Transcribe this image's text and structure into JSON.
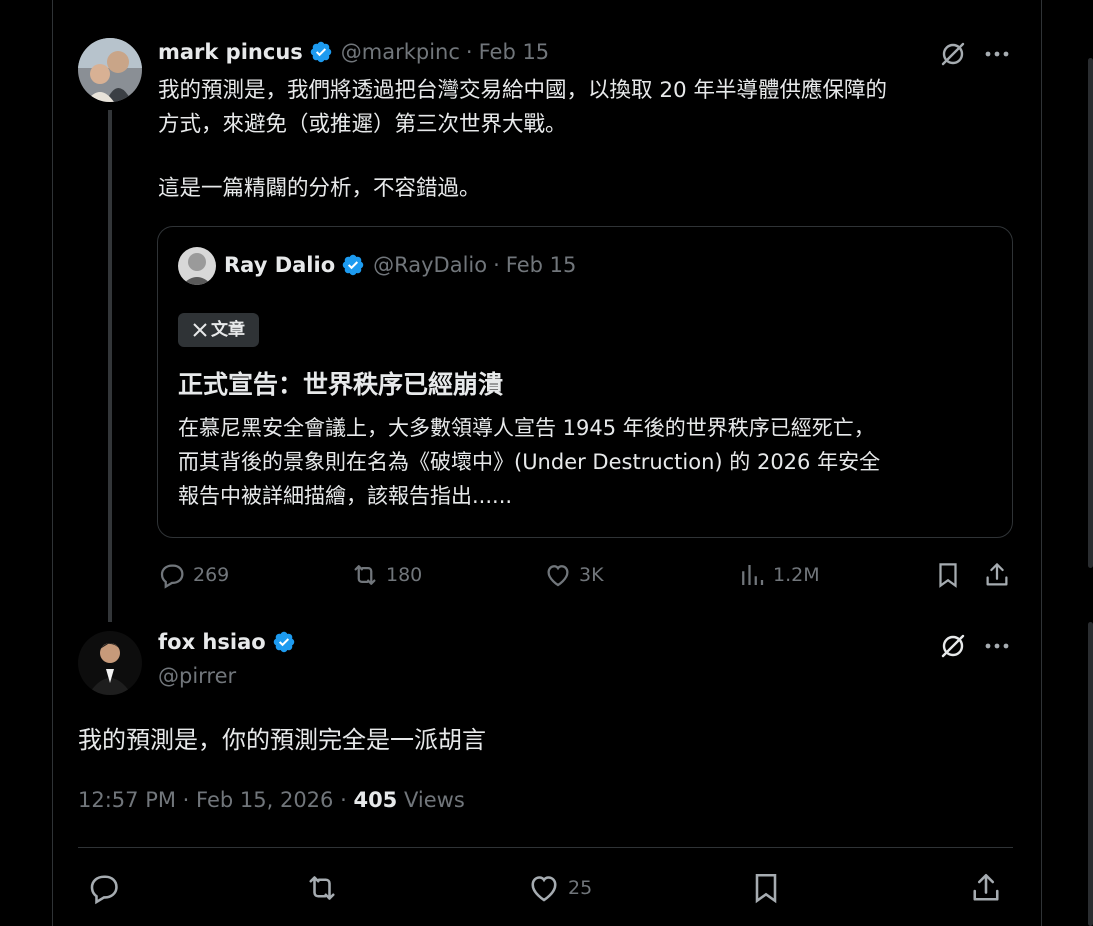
{
  "parent": {
    "display_name": "mark pincus",
    "handle": "@markpinc",
    "date": "Feb 15",
    "text_line1": "我的預測是，我們將透過把台灣交易給中國，以換取 20 年半導體供應保障的",
    "text_line2": "方式，來避免（或推遲）第三次世界大戰。",
    "text_line3": "這是一篇精闢的分析，不容錯過。",
    "quote": {
      "display_name": "Ray Dalio",
      "handle": "@RayDalio",
      "date": "Feb 15",
      "badge": "文章",
      "article_title": "正式宣告：世界秩序已經崩潰",
      "snippet_line1": "在慕尼黑安全會議上，大多數領導人宣告 1945 年後的世界秩序已經死亡，",
      "snippet_line2": "而其背後的景象則在名為《破壞中》(Under Destruction) 的 2026 年安全",
      "snippet_line3": "報告中被詳細描繪，該報告指出......"
    },
    "actions": {
      "replies": "269",
      "reposts": "180",
      "likes": "3K",
      "views": "1.2M"
    }
  },
  "reply": {
    "display_name": "fox hsiao",
    "handle": "@pirrer",
    "text": "我的預測是，你的預測完全是一派胡言",
    "time": "12:57 PM",
    "date": "Feb 15, 2026",
    "views_count": "405",
    "views_label": "Views",
    "likes": "25"
  },
  "colors": {
    "background": "#000000",
    "text": "#e7e9ea",
    "muted": "#71767b",
    "border": "#2f3336",
    "verified": "#1d9bf0"
  }
}
